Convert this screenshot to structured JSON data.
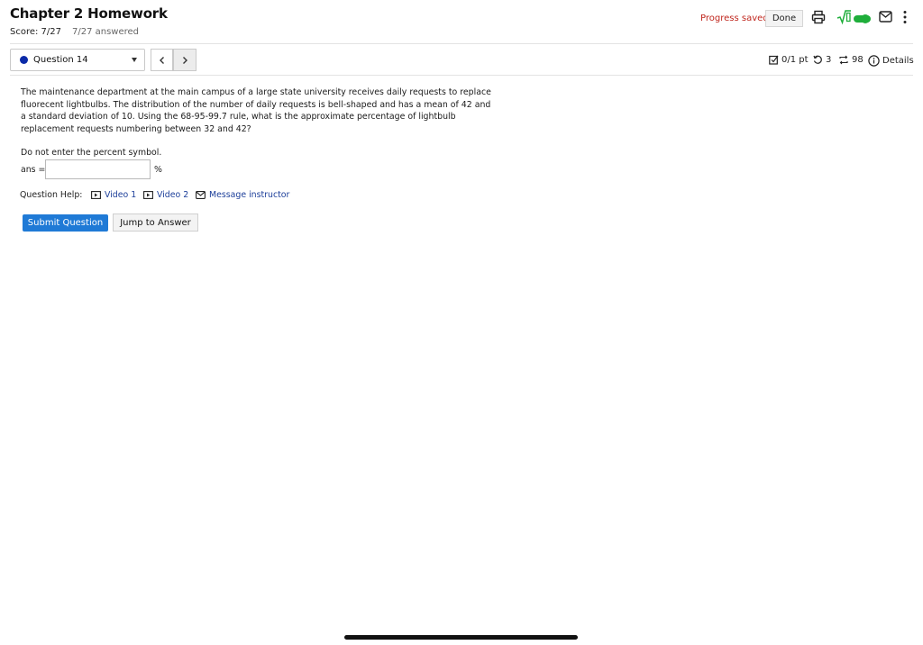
{
  "header": {
    "title": "Chapter 2 Homework",
    "score": "Score: 7/27",
    "answered": "7/27 answered",
    "progress_saved": "Progress saved",
    "done_label": "Done",
    "accent_color": "#1f7ad6",
    "toggle_color": "#1fae3b",
    "toggle_on": true,
    "icons": [
      "print-icon",
      "sqrt-toggle-icon",
      "mail-icon",
      "kebab-menu-icon"
    ]
  },
  "question_nav": {
    "selected": "Question 14",
    "prev_icon": "chevron-left-icon",
    "next_icon": "chevron-right-icon"
  },
  "meta": {
    "points": "0/1 pt",
    "retries": "3",
    "attempts": "98",
    "details": "Details"
  },
  "question": {
    "text": "The maintenance department at the main campus of a large state university receives daily requests to replace fluorecent lightbulbs. The distribution of the number of daily requests is bell-shaped and has a mean of 42 and a standard deviation of 10. Using the 68-95-99.7 rule, what is the approximate percentage of lightbulb replacement requests numbering between 32 and 42?",
    "instruction": "Do not enter the percent symbol.",
    "answer_label": "ans =",
    "answer_value": "",
    "unit": "%"
  },
  "help": {
    "label": "Question Help:",
    "video1": "Video 1",
    "video2": "Video 2",
    "message": "Message instructor"
  },
  "actions": {
    "submit": "Submit Question",
    "jump": "Jump to Answer"
  }
}
